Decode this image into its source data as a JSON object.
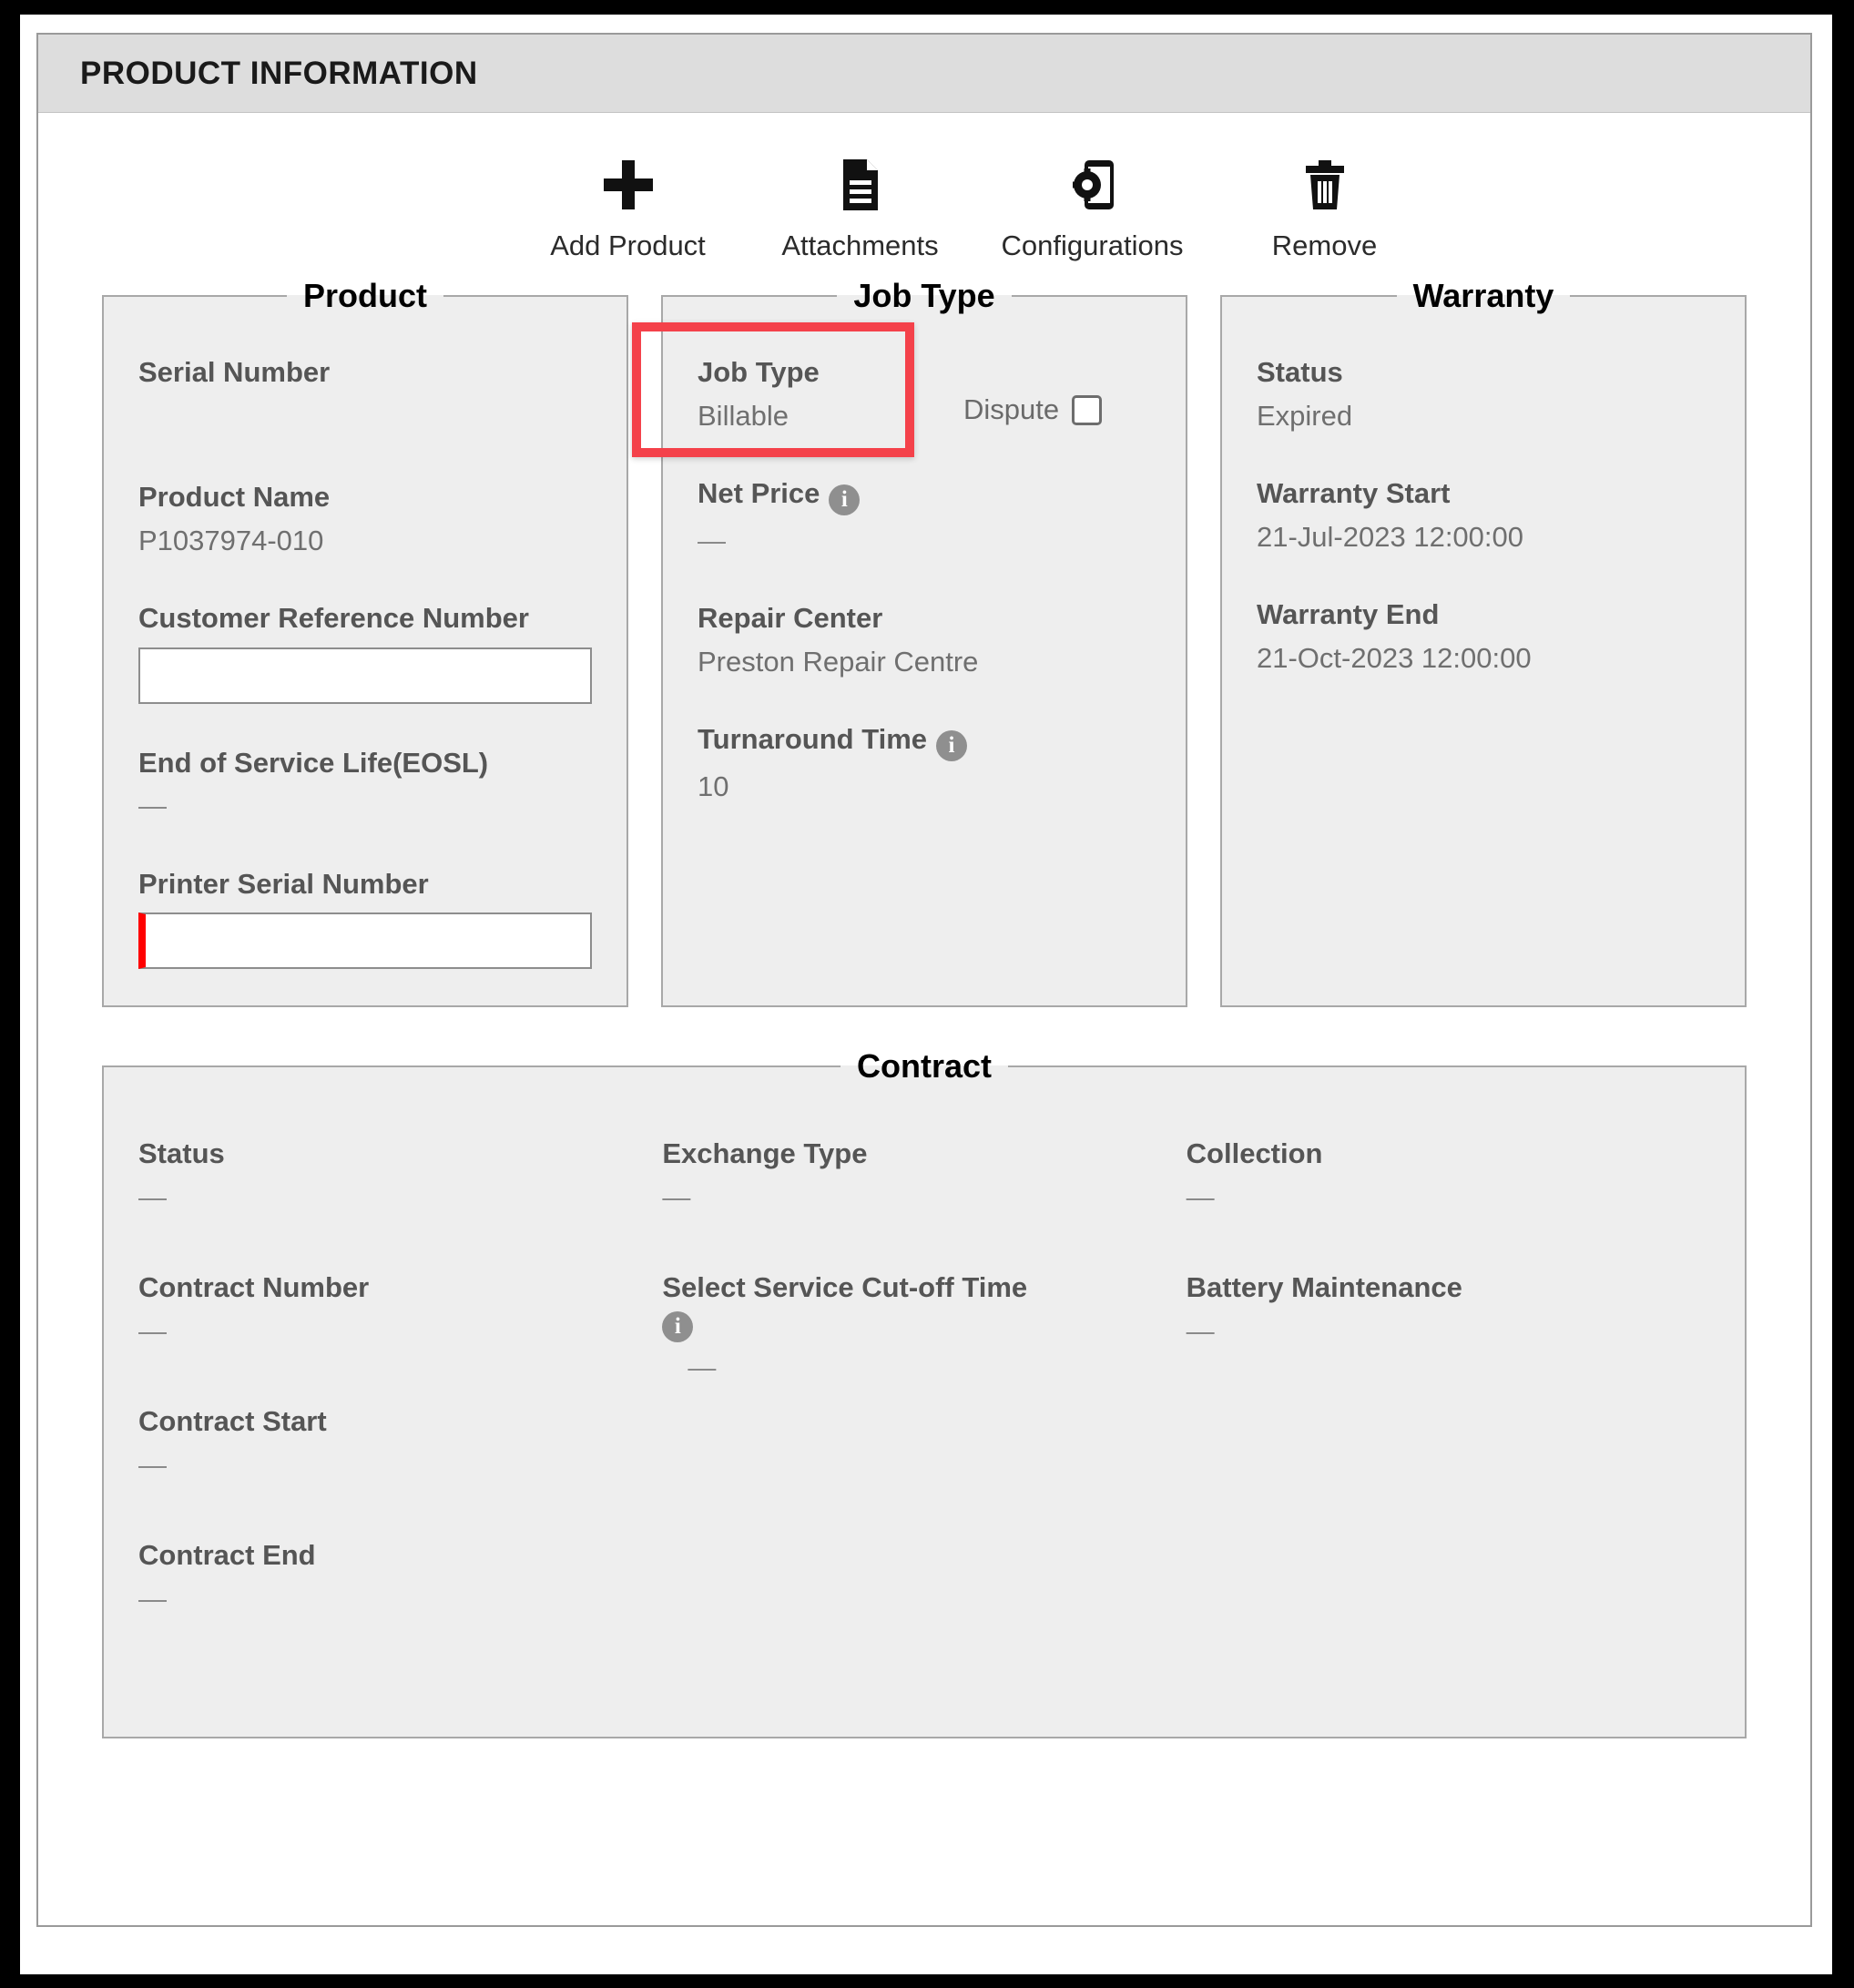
{
  "header": {
    "title": "PRODUCT INFORMATION"
  },
  "toolbar": {
    "items": [
      {
        "label": "Add Product",
        "icon": "plus-icon"
      },
      {
        "label": "Attachments",
        "icon": "document-icon"
      },
      {
        "label": "Configurations",
        "icon": "device-gear-icon"
      },
      {
        "label": "Remove",
        "icon": "trash-icon"
      }
    ]
  },
  "product": {
    "legend": "Product",
    "serial_number_label": "Serial Number",
    "serial_number_value": "",
    "product_name_label": "Product Name",
    "product_name_value": "P1037974-010",
    "customer_reference_label": "Customer Reference Number",
    "customer_reference_value": "",
    "customer_reference_placeholder": "",
    "eosl_label": "End of Service Life(EOSL)",
    "eosl_value": "—",
    "printer_serial_label": "Printer Serial Number",
    "printer_serial_value": "",
    "printer_serial_placeholder": ""
  },
  "job_type": {
    "legend": "Job Type",
    "job_type_label": "Job Type",
    "job_type_value": "Billable",
    "dispute_label": "Dispute",
    "dispute_checked": false,
    "net_price_label": "Net Price",
    "net_price_value": "—",
    "repair_center_label": "Repair Center",
    "repair_center_value": "Preston Repair Centre",
    "turnaround_label": "Turnaround Time",
    "turnaround_value": "10",
    "info_glyph": "i"
  },
  "warranty": {
    "legend": "Warranty",
    "status_label": "Status",
    "status_value": "Expired",
    "start_label": "Warranty Start",
    "start_value": "21-Jul-2023 12:00:00",
    "end_label": "Warranty End",
    "end_value": "21-Oct-2023 12:00:00"
  },
  "contract": {
    "legend": "Contract",
    "col1": [
      {
        "label": "Status",
        "value": "—"
      },
      {
        "label": "Contract Number",
        "value": "—"
      },
      {
        "label": "Contract Start",
        "value": "—"
      },
      {
        "label": "Contract End",
        "value": "—"
      }
    ],
    "col2": [
      {
        "label": "Exchange Type",
        "value": "—"
      },
      {
        "label": "Select Service Cut-off Time",
        "value": "—"
      }
    ],
    "col3": [
      {
        "label": "Collection",
        "value": "—"
      },
      {
        "label": "Battery Maintenance",
        "value": "—"
      }
    ]
  },
  "annotation": {
    "target": "job-type-field",
    "color": "#f4414a"
  }
}
